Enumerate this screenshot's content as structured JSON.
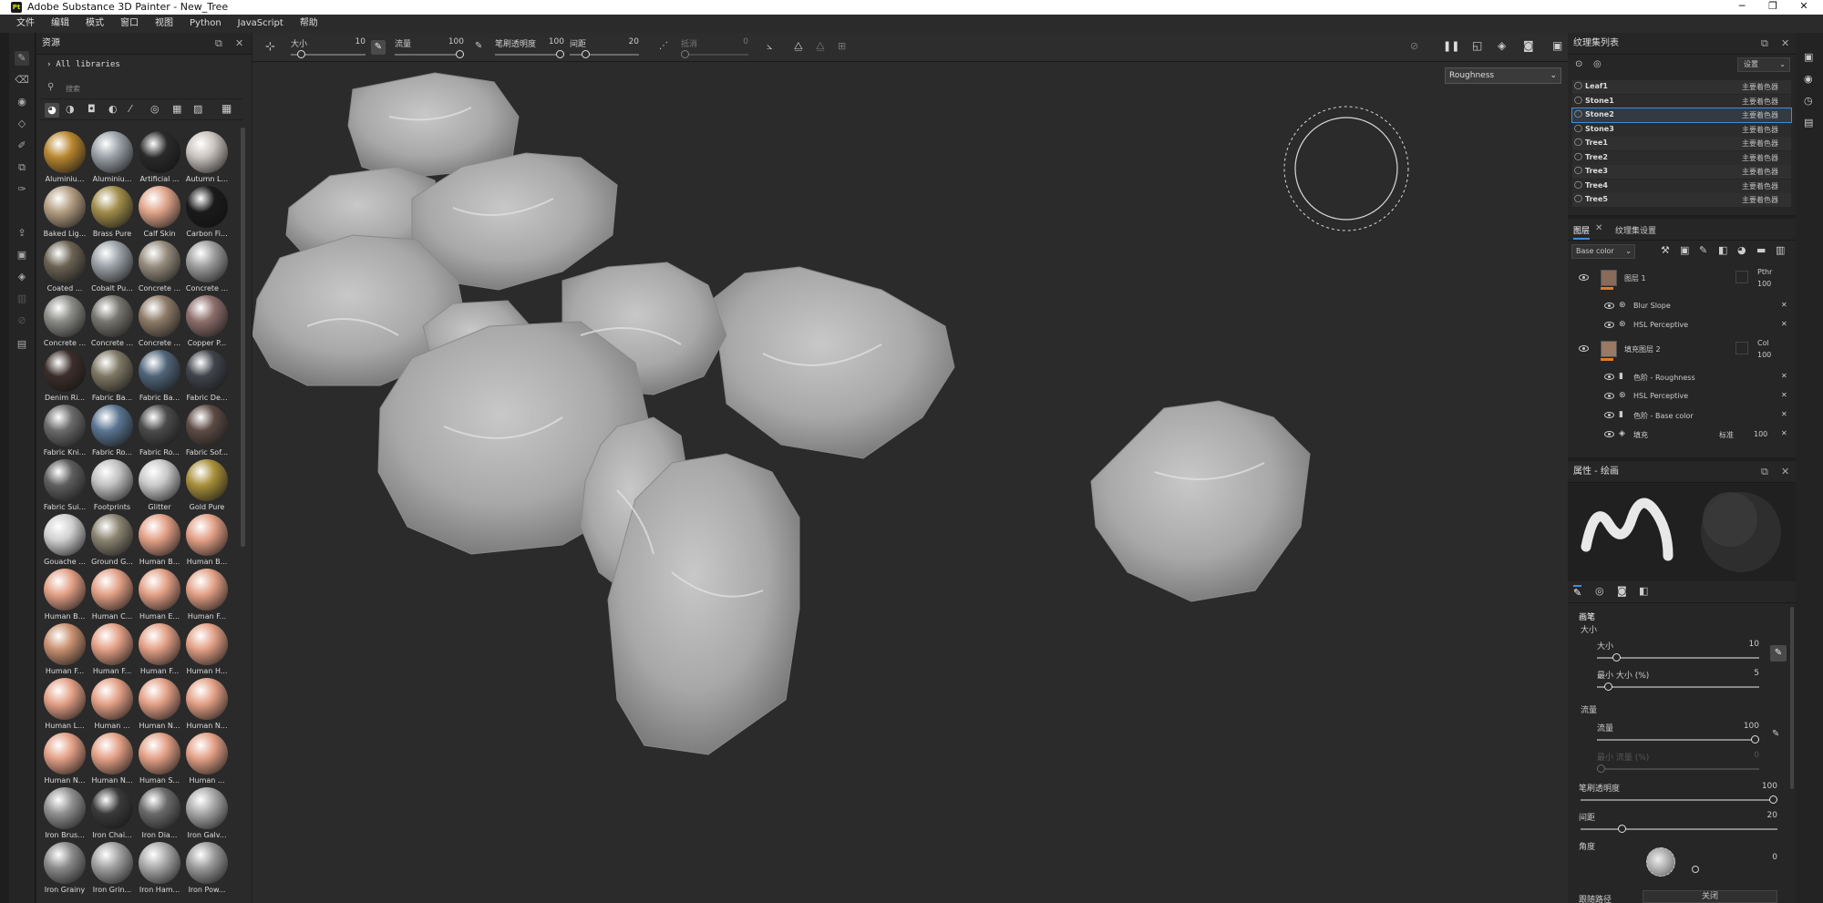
{
  "window": {
    "title": "Adobe Substance 3D Painter - New_Tree",
    "logo": "Pt"
  },
  "menu": [
    "文件",
    "编辑",
    "模式",
    "窗口",
    "视图",
    "Python",
    "JavaScript",
    "帮助"
  ],
  "assets": {
    "title": "资源",
    "breadcrumb": "All libraries",
    "search_placeholder": "搜索",
    "items": [
      "Aluminiu...",
      "Aluminiu...",
      "Artificial ...",
      "Autumn L...",
      "Baked Lig...",
      "Brass Pure",
      "Calf Skin",
      "Carbon Fi...",
      "Coated ...",
      "Cobalt Pu...",
      "Concrete ...",
      "Concrete ...",
      "Concrete ...",
      "Concrete ...",
      "Concrete ...",
      "Copper P...",
      "Denim Ri...",
      "Fabric Ba...",
      "Fabric Ba...",
      "Fabric De...",
      "Fabric Kni...",
      "Fabric Ro...",
      "Fabric Ro...",
      "Fabric Sof...",
      "Fabric Sui...",
      "Footprints",
      "Glitter",
      "Gold Pure",
      "Gouache ...",
      "Ground G...",
      "Human B...",
      "Human B...",
      "Human B...",
      "Human C...",
      "Human E...",
      "Human F...",
      "Human F...",
      "Human F...",
      "Human F...",
      "Human H...",
      "Human L...",
      "Human ...",
      "Human N...",
      "Human N...",
      "Human N...",
      "Human N...",
      "Human S...",
      "Human ...",
      "Iron Brus...",
      "Iron Chai...",
      "Iron Dia...",
      "Iron Galv...",
      "Iron Grainy",
      "Iron Grin...",
      "Iron Ham...",
      "Iron Pow..."
    ],
    "colors": [
      "#b8862f",
      "#9aa0a6",
      "#2a2a2a",
      "#c8c2bd",
      "#b39d82",
      "#a08c4a",
      "#e0a48a",
      "#1a1a1a",
      "#6b6253",
      "#9aa0a6",
      "#958b7d",
      "#9d9d9d",
      "#8a8a86",
      "#77756f",
      "#8d7b68",
      "#8c6e6a",
      "#3b2e2a",
      "#7d7764",
      "#4f6478",
      "#40444a",
      "#6a6a6a",
      "#5a7591",
      "#4a4a4a",
      "#5c4a44",
      "#5e5e5e",
      "#c0c0c0",
      "#c8c8c8",
      "#a88f3a",
      "#d0d0d0",
      "#8a8270",
      "#e3a086",
      "#e3a086",
      "#e3a086",
      "#e3a086",
      "#e3a086",
      "#e3a086",
      "#c89070",
      "#e3a086",
      "#e3a086",
      "#e3a086",
      "#e3a086",
      "#e3a086",
      "#e3a086",
      "#e3a086",
      "#e3a086",
      "#e3a086",
      "#e3a086",
      "#e3a086",
      "#909090",
      "#3a3a3a",
      "#6a6a6a",
      "#a8a8a8",
      "#8a8a8a",
      "#a0a0a0",
      "#a8a8a8",
      "#9a9a9a"
    ]
  },
  "toolbar": {
    "size": {
      "label": "大小",
      "value": "10",
      "level": 0.1
    },
    "flow": {
      "label": "流量",
      "value": "100",
      "level": 1.0
    },
    "opacity": {
      "label": "笔刷透明度",
      "value": "100",
      "level": 1.0
    },
    "spacing": {
      "label": "间距",
      "value": "20",
      "level": 0.2
    },
    "jitter": {
      "label": "抵消",
      "value": "0",
      "level": 0.0
    }
  },
  "viewport": {
    "channel": "Roughness"
  },
  "texture_sets": {
    "title": "纹理集列表",
    "settings_label": "设置",
    "rows": [
      {
        "name": "Leaf1",
        "shader": "主要着色器"
      },
      {
        "name": "Stone1",
        "shader": "主要着色器"
      },
      {
        "name": "Stone2",
        "shader": "主要着色器"
      },
      {
        "name": "Stone3",
        "shader": "主要着色器"
      },
      {
        "name": "Tree1",
        "shader": "主要着色器"
      },
      {
        "name": "Tree2",
        "shader": "主要着色器"
      },
      {
        "name": "Tree3",
        "shader": "主要着色器"
      },
      {
        "name": "Tree4",
        "shader": "主要着色器"
      },
      {
        "name": "Tree5",
        "shader": "主要着色器"
      }
    ]
  },
  "layers": {
    "tab_layers": "图层",
    "tab_settings": "纹理集设置",
    "channel": "Base color",
    "layer1": {
      "name": "图层 1",
      "blend": "Pthr",
      "opacity": "100"
    },
    "layer1_effects": [
      "Blur Slope",
      "HSL Perceptive"
    ],
    "layer2": {
      "name": "填充图层 2",
      "blend": "Col",
      "opacity": "100"
    },
    "layer2_effects": [
      "色阶 - Roughness",
      "HSL Perceptive",
      "色阶 - Base color"
    ],
    "fill": {
      "name": "填充",
      "blend": "标准",
      "opacity": "100"
    }
  },
  "properties": {
    "title": "属性 - 绘画",
    "brush_section": "画笔",
    "size_header": "大小",
    "size": {
      "label": "大小",
      "value": "10",
      "level": 0.1
    },
    "min_size": {
      "label": "最小 大小 (%)",
      "value": "5",
      "level": 0.05
    },
    "flow_section": "流量",
    "flow": {
      "label": "流量",
      "value": "100",
      "level": 1.0
    },
    "min_flow": {
      "label": "最小 流量 (%)",
      "value": "0",
      "level": 0.0
    },
    "opacity": {
      "label": "笔刷透明度",
      "value": "100",
      "level": 1.0
    },
    "spacing": {
      "label": "间距",
      "value": "20",
      "level": 0.2
    },
    "angle": {
      "label": "角度",
      "value": "0"
    },
    "stroke_path": {
      "label": "跟随路径",
      "value": "关闭"
    }
  }
}
